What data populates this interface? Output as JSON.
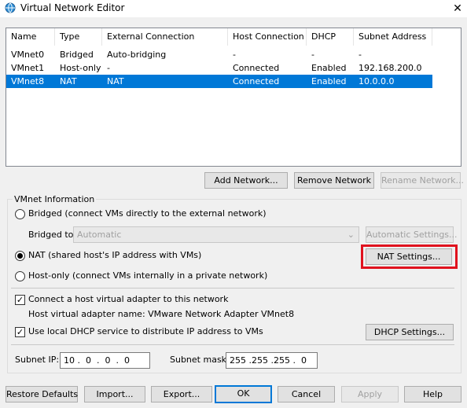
{
  "window": {
    "title": "Virtual Network Editor",
    "close_glyph": "✕"
  },
  "network_table": {
    "columns": [
      "Name",
      "Type",
      "External Connection",
      "Host Connection",
      "DHCP",
      "Subnet Address"
    ],
    "rows": [
      {
        "name": "VMnet0",
        "type": "Bridged",
        "external": "Auto-bridging",
        "host": "-",
        "dhcp": "-",
        "subnet": "-"
      },
      {
        "name": "VMnet1",
        "type": "Host-only",
        "external": "-",
        "host": "Connected",
        "dhcp": "Enabled",
        "subnet": "192.168.200.0"
      },
      {
        "name": "VMnet8",
        "type": "NAT",
        "external": "NAT",
        "host": "Connected",
        "dhcp": "Enabled",
        "subnet": "10.0.0.0"
      }
    ],
    "selected_row": 2
  },
  "table_buttons": {
    "add": "Add Network...",
    "remove": "Remove Network",
    "rename": "Rename Network..."
  },
  "vmnet_info": {
    "legend": "VMnet Information",
    "bridged_label": "Bridged (connect VMs directly to the external network)",
    "bridged_to_label": "Bridged to:",
    "bridged_to_value": "Automatic",
    "automatic_settings": "Automatic Settings...",
    "nat_label": "NAT (shared host's IP address with VMs)",
    "nat_settings": "NAT Settings...",
    "hostonly_label": "Host-only (connect VMs internally in a private network)",
    "connect_adapter_label": "Connect a host virtual adapter to this network",
    "adapter_name_label": "Host virtual adapter name: VMware Network Adapter VMnet8",
    "dhcp_label": "Use local DHCP service to distribute IP address to VMs",
    "dhcp_settings": "DHCP Settings...",
    "subnet_ip_label": "Subnet IP:",
    "subnet_ip_value": "10 .  0  .  0  .  0",
    "subnet_mask_label": "Subnet mask:",
    "subnet_mask_value": "255 .255 .255 .  0",
    "selected_mode": "nat",
    "connect_adapter_checked": true,
    "dhcp_checked": true
  },
  "footer_buttons": {
    "restore": "Restore Defaults",
    "import": "Import...",
    "export": "Export...",
    "ok": "OK",
    "cancel": "Cancel",
    "apply": "Apply",
    "help": "Help"
  },
  "colors": {
    "selection": "#0078d7",
    "highlight_box": "#e0121e"
  }
}
